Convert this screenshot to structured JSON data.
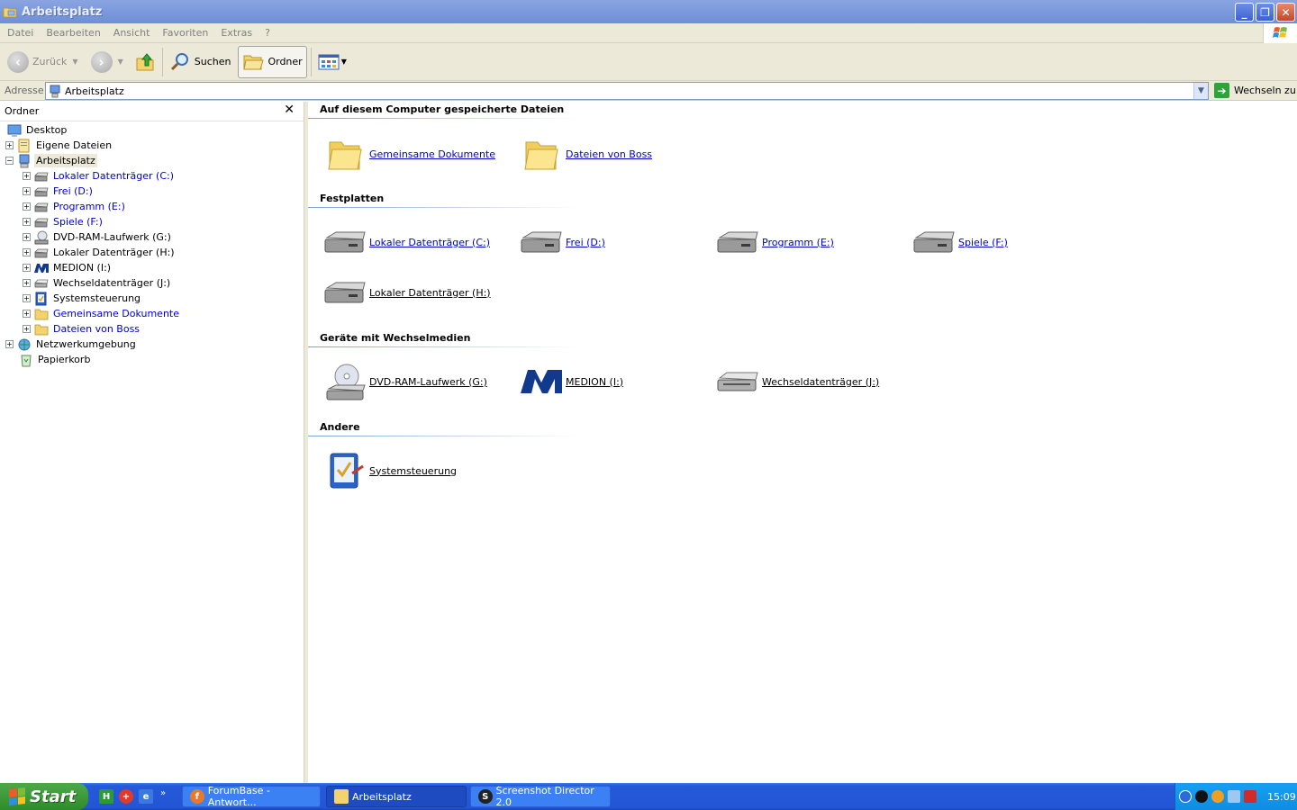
{
  "window": {
    "title": "Arbeitsplatz",
    "buttons": [
      "_",
      "❐",
      "✕"
    ]
  },
  "menu": [
    "Datei",
    "Bearbeiten",
    "Ansicht",
    "Favoriten",
    "Extras",
    "?"
  ],
  "toolbar": {
    "back": "Zurück",
    "search": "Suchen",
    "folders": "Ordner"
  },
  "address": {
    "label": "Adresse",
    "value": "Arbeitsplatz",
    "go": "Wechseln zu"
  },
  "folder_pane": {
    "title": "Ordner",
    "close": "✕",
    "tree": [
      {
        "label": "Desktop",
        "level": 0,
        "expander": "",
        "icon": "desktop-icon"
      },
      {
        "label": "Eigene Dateien",
        "level": 1,
        "expander": "+",
        "icon": "my-documents-icon"
      },
      {
        "label": "Arbeitsplatz",
        "level": 1,
        "expander": "−",
        "icon": "my-computer-icon",
        "selected": true
      },
      {
        "label": "Lokaler Datenträger (C:)",
        "level": 2,
        "expander": "+",
        "icon": "drive-icon",
        "blue": true
      },
      {
        "label": "Frei (D:)",
        "level": 2,
        "expander": "+",
        "icon": "drive-icon",
        "blue": true
      },
      {
        "label": "Programm (E:)",
        "level": 2,
        "expander": "+",
        "icon": "drive-icon",
        "blue": true
      },
      {
        "label": "Spiele (F:)",
        "level": 2,
        "expander": "+",
        "icon": "drive-icon",
        "blue": true
      },
      {
        "label": "DVD-RAM-Laufwerk (G:)",
        "level": 2,
        "expander": "+",
        "icon": "dvd-icon"
      },
      {
        "label": "Lokaler Datenträger (H:)",
        "level": 2,
        "expander": "+",
        "icon": "drive-icon"
      },
      {
        "label": "MEDION (I:)",
        "level": 2,
        "expander": "+",
        "icon": "medion-icon"
      },
      {
        "label": "Wechseldatenträger (J:)",
        "level": 2,
        "expander": "+",
        "icon": "removable-icon"
      },
      {
        "label": "Systemsteuerung",
        "level": 2,
        "expander": "+",
        "icon": "control-panel-icon"
      },
      {
        "label": "Gemeinsame Dokumente",
        "level": 2,
        "expander": "+",
        "icon": "folder-icon",
        "blue": true
      },
      {
        "label": "Dateien von Boss",
        "level": 2,
        "expander": "+",
        "icon": "folder-icon",
        "blue": true
      },
      {
        "label": "Netzwerkumgebung",
        "level": 1,
        "expander": "+",
        "icon": "network-icon"
      },
      {
        "label": "Papierkorb",
        "level": 1,
        "expander": "",
        "icon": "recycle-bin-icon"
      }
    ]
  },
  "groups": {
    "stored": {
      "title": "Auf diesem Computer gespeicherte Dateien",
      "items": [
        "Gemeinsame Dokumente",
        "Dateien von Boss"
      ]
    },
    "drives": {
      "title": "Festplatten",
      "items": [
        "Lokaler Datenträger (C:)",
        "Frei (D:)",
        "Programm (E:)",
        "Spiele (F:)",
        "Lokaler Datenträger (H:)"
      ]
    },
    "removable": {
      "title": "Geräte mit Wechselmedien",
      "items": [
        "DVD-RAM-Laufwerk (G:)",
        "MEDION (I:)",
        "Wechseldatenträger (J:)"
      ]
    },
    "other": {
      "title": "Andere",
      "items": [
        "Systemsteuerung"
      ]
    }
  },
  "taskbar": {
    "start": "Start",
    "quicklaunch_more": "»",
    "tasks": [
      "ForumBase - Antwort...",
      "Arbeitsplatz",
      "Screenshot Director 2.0"
    ],
    "clock": "15:09"
  }
}
